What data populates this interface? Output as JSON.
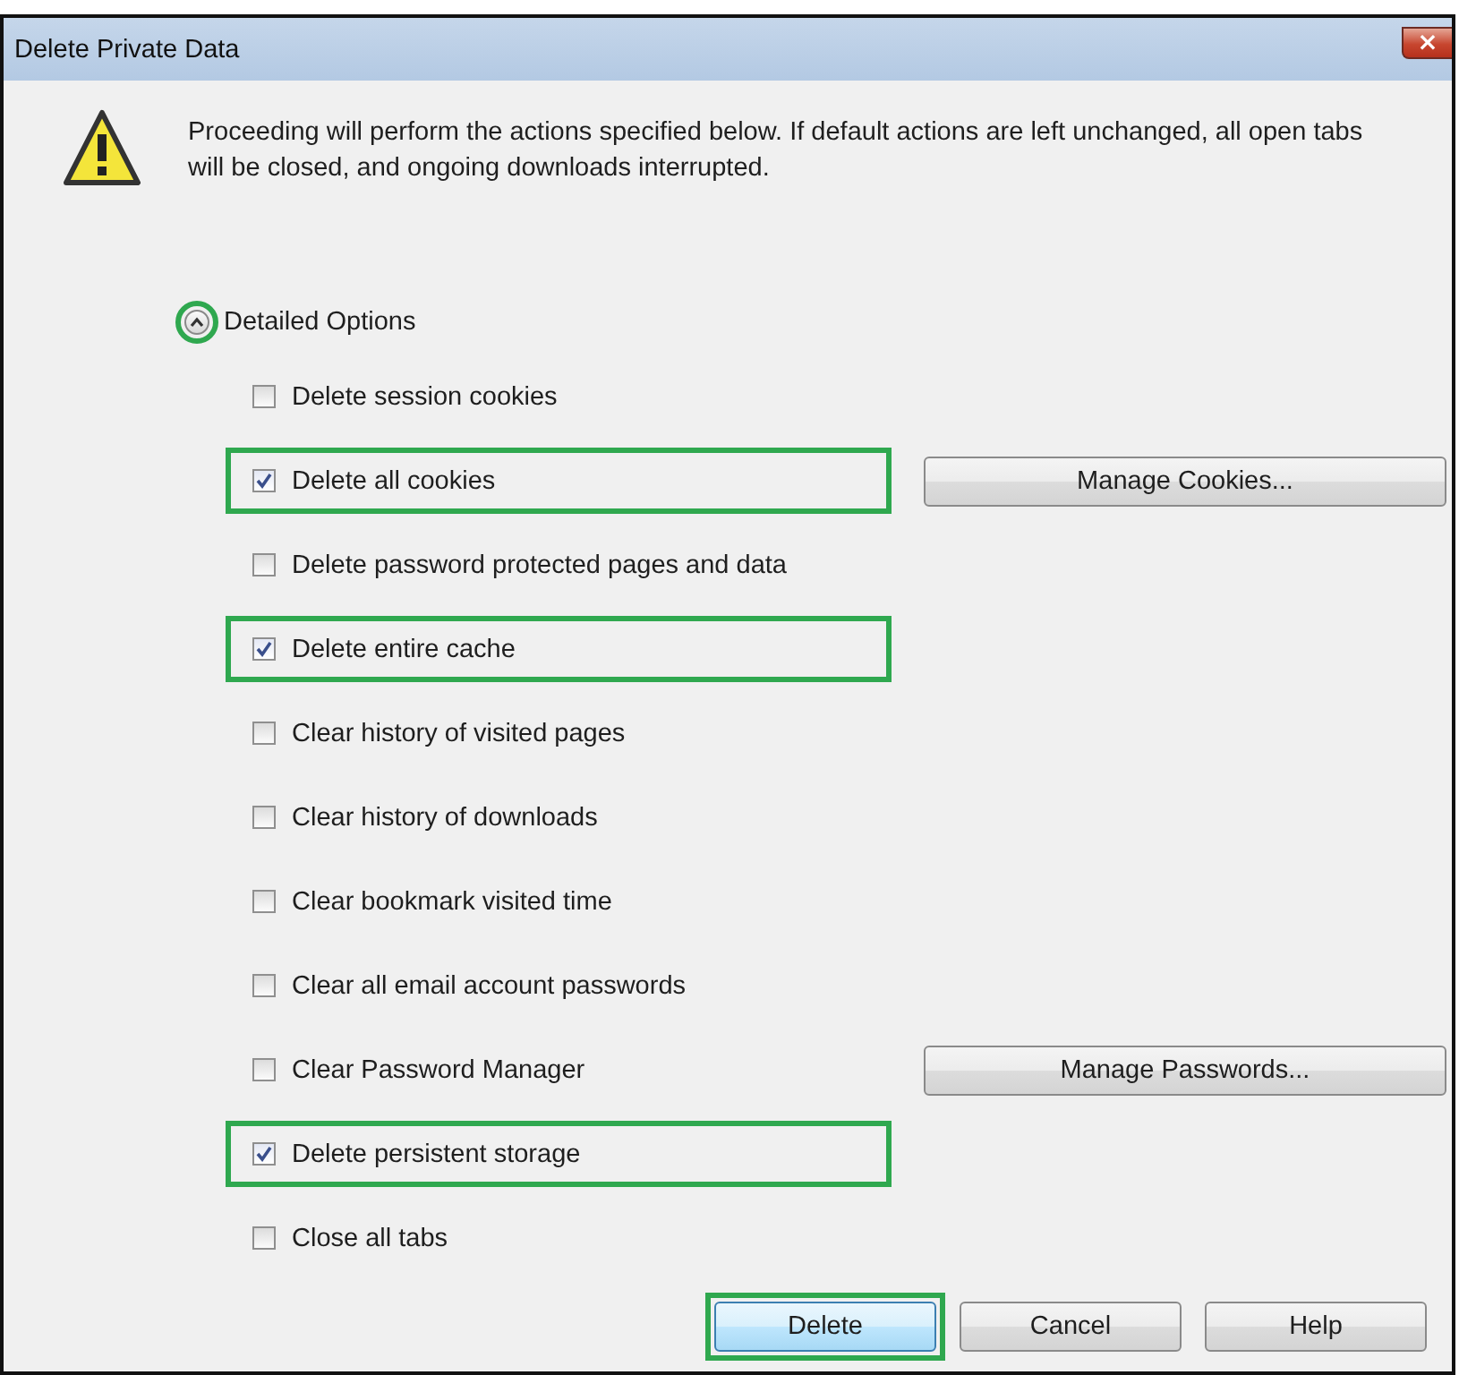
{
  "window": {
    "title": "Delete Private Data",
    "close": "×"
  },
  "message": "Proceeding will perform the actions specified below. If default actions are left unchanged, all open tabs will be closed, and ongoing downloads interrupted.",
  "details": {
    "label": "Detailed Options",
    "expanded": true,
    "highlighted": true
  },
  "options": [
    {
      "label": "Delete session cookies",
      "checked": false,
      "highlighted": false
    },
    {
      "label": "Delete all cookies",
      "checked": true,
      "highlighted": true,
      "button": "Manage Cookies..."
    },
    {
      "label": "Delete password protected pages and data",
      "checked": false,
      "highlighted": false
    },
    {
      "label": "Delete entire cache",
      "checked": true,
      "highlighted": true
    },
    {
      "label": "Clear history of visited pages",
      "checked": false,
      "highlighted": false
    },
    {
      "label": "Clear history of downloads",
      "checked": false,
      "highlighted": false
    },
    {
      "label": "Clear bookmark visited time",
      "checked": false,
      "highlighted": false
    },
    {
      "label": "Clear all email account passwords",
      "checked": false,
      "highlighted": false
    },
    {
      "label": "Clear Password Manager",
      "checked": false,
      "highlighted": false,
      "button": "Manage Passwords..."
    },
    {
      "label": "Delete persistent storage",
      "checked": true,
      "highlighted": true
    },
    {
      "label": "Close all tabs",
      "checked": false,
      "highlighted": false
    }
  ],
  "buttons": [
    {
      "label": "Delete",
      "default": true,
      "highlighted": true
    },
    {
      "label": "Cancel",
      "default": false,
      "highlighted": false
    },
    {
      "label": "Help",
      "default": false,
      "highlighted": false
    }
  ]
}
